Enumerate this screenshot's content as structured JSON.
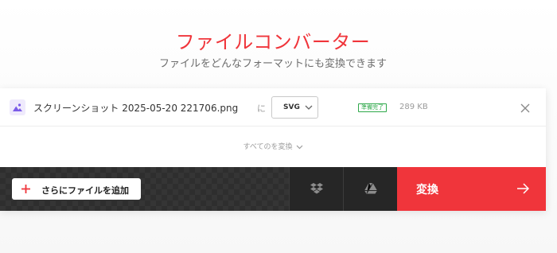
{
  "header": {
    "title": "ファイルコンバーター",
    "subtitle": "ファイルをどんなフォーマットにも変換できます"
  },
  "file": {
    "icon": "image-icon",
    "name": "スクリーンショット 2025-05-20 221706.png",
    "to_label": "に",
    "format": "SVG",
    "status": "準備完了",
    "size": "289 KB"
  },
  "convert_all": {
    "label": "すべてのを変換"
  },
  "actions": {
    "add_files_label": "さらにファイルを追加",
    "convert_label": "変換",
    "dropbox_icon": "dropbox-icon",
    "drive_icon": "google-drive-icon"
  },
  "colors": {
    "accent": "#f0353b",
    "status": "#2ea84a",
    "toolbar": "#2e2e2e"
  }
}
